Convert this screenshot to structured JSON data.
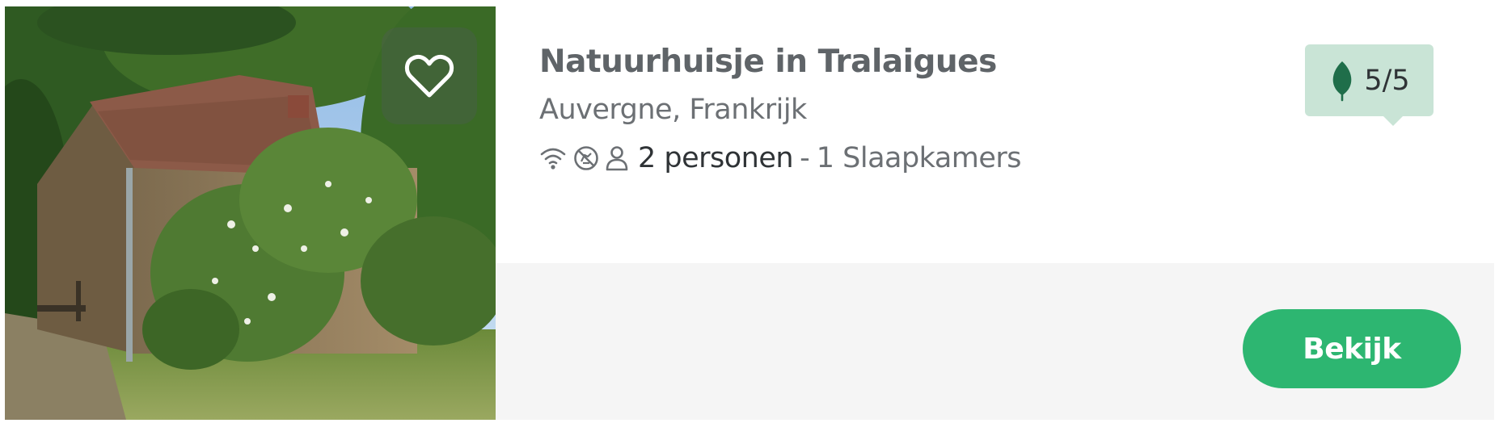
{
  "listing": {
    "title": "Natuurhuisje in Tralaigues",
    "location": "Auvergne, Frankrijk",
    "persons": "2 personen",
    "separator": "-",
    "bedrooms": "1 Slaapkamers",
    "eco_score": "5/5",
    "cta_label": "Bekijk",
    "feature_icons": [
      "wifi-icon",
      "no-pets-icon",
      "person-icon"
    ]
  },
  "colors": {
    "title": "#5f6468",
    "subtitle": "#6c7074",
    "text_dark": "#2f3336",
    "eco_badge_bg": "#c9e4d6",
    "eco_leaf": "#1f6e4a",
    "cta_bg": "#2db671",
    "footer_bg": "#f5f5f5"
  }
}
